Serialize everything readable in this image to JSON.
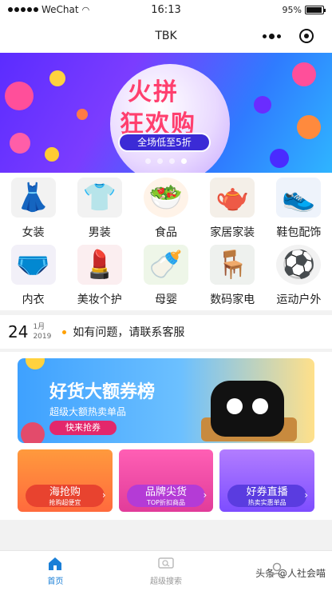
{
  "status_bar": {
    "carrier": "WeChat",
    "time": "16:13",
    "battery": "95%",
    "battery_level": 0.95
  },
  "navbar": {
    "title": "TBK"
  },
  "banner": {
    "title_line1": "火拼",
    "title_line2": "狂欢购",
    "subtitle": "全场低至5折",
    "slides": 4,
    "active_slide": 1
  },
  "categories": [
    {
      "label": "女装",
      "icon": "dress-icon"
    },
    {
      "label": "男装",
      "icon": "tshirt-icon"
    },
    {
      "label": "食品",
      "icon": "food-icon"
    },
    {
      "label": "家居家装",
      "icon": "kettle-icon"
    },
    {
      "label": "鞋包配饰",
      "icon": "sneaker-icon"
    },
    {
      "label": "内衣",
      "icon": "underwear-icon"
    },
    {
      "label": "美妆个护",
      "icon": "lipstick-icon"
    },
    {
      "label": "母婴",
      "icon": "milk-powder-icon"
    },
    {
      "label": "数码家电",
      "icon": "chair-icon"
    },
    {
      "label": "运动户外",
      "icon": "soccer-ball-icon"
    }
  ],
  "notice": {
    "day": "24",
    "month": "1月",
    "year": "2019",
    "text": "如有问题，请联系客服"
  },
  "promo": {
    "hero": {
      "title": "好货大额券榜",
      "subtitle": "超级大额热卖单品",
      "button": "快来抢券"
    },
    "tiles": [
      {
        "title": "海抢购",
        "subtitle": "抢购超便宜"
      },
      {
        "title": "品牌尖货",
        "subtitle": "TOP折扣商品"
      },
      {
        "title": "好券直播",
        "subtitle": "热卖实惠单品"
      }
    ]
  },
  "tabbar": {
    "tabs": [
      {
        "label": "首页",
        "icon": "home-icon",
        "active": true
      },
      {
        "label": "超级搜索",
        "icon": "search-chat-icon",
        "active": false
      },
      {
        "label": "",
        "icon": "user-icon",
        "active": false
      }
    ]
  },
  "watermark": "头条 @人社会喵",
  "colors": {
    "accent": "#1a7fd7",
    "banner_start": "#5b2cff",
    "banner_end": "#2fb5ff",
    "notice_bullet": "#ffa000"
  }
}
